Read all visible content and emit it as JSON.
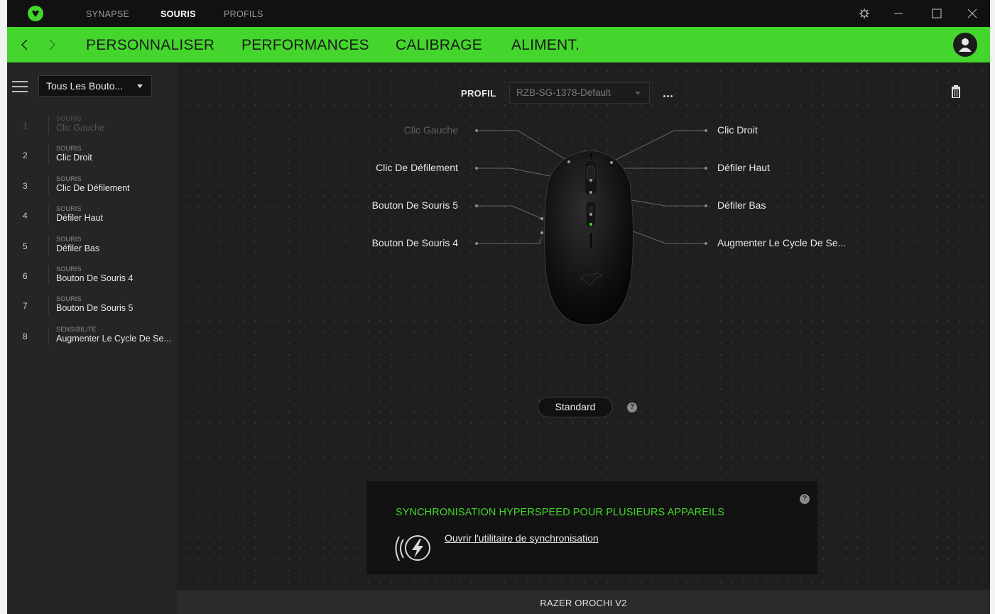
{
  "titlebar": {
    "tabs": [
      {
        "label": "SYNAPSE"
      },
      {
        "label": "SOURIS"
      },
      {
        "label": "PROFILS"
      }
    ]
  },
  "nav": {
    "tabs": [
      {
        "label": "PERSONNALISER"
      },
      {
        "label": "PERFORMANCES"
      },
      {
        "label": "CALIBRAGE"
      },
      {
        "label": "ALIMENT."
      }
    ]
  },
  "sidebar": {
    "dropdown_value": "Tous Les Bouto...",
    "items": [
      {
        "num": "1",
        "category": "SOURIS",
        "name": "Clic Gauche"
      },
      {
        "num": "2",
        "category": "SOURIS",
        "name": "Clic Droit"
      },
      {
        "num": "3",
        "category": "SOURIS",
        "name": "Clic De Défilement"
      },
      {
        "num": "4",
        "category": "SOURIS",
        "name": "Défiler Haut"
      },
      {
        "num": "5",
        "category": "SOURIS",
        "name": "Défiler  Bas"
      },
      {
        "num": "6",
        "category": "SOURIS",
        "name": "Bouton De Souris 4"
      },
      {
        "num": "7",
        "category": "SOURIS",
        "name": "Bouton De Souris 5"
      },
      {
        "num": "8",
        "category": "SENSIBILITÉ",
        "name": "Augmenter Le Cycle De Se..."
      }
    ]
  },
  "profile": {
    "label": "PROFIL",
    "selected": "RZB-SG-1378-Default"
  },
  "mouse_labels": {
    "left_click": "Clic Gauche",
    "scroll_click": "Clic De Défilement",
    "mouse_button_5": "Bouton De Souris 5",
    "mouse_button_4": "Bouton De Souris 4",
    "right_click": "Clic Droit",
    "scroll_up": "Défiler Haut",
    "scroll_down": "Défiler  Bas",
    "sensitivity_cycle": "Augmenter Le Cycle De Se..."
  },
  "mode_button": "Standard",
  "sync": {
    "title": "SYNCHRONISATION HYPERSPEED POUR PLUSIEURS APPAREILS",
    "link": "Ouvrir l'utilitaire de synchronisation"
  },
  "footer": {
    "device_name": "RAZER OROCHI V2"
  },
  "help_glyph": "?",
  "colors": {
    "accent": "#44d62c",
    "background": "#1f1f1f",
    "sidebar": "#252525"
  }
}
